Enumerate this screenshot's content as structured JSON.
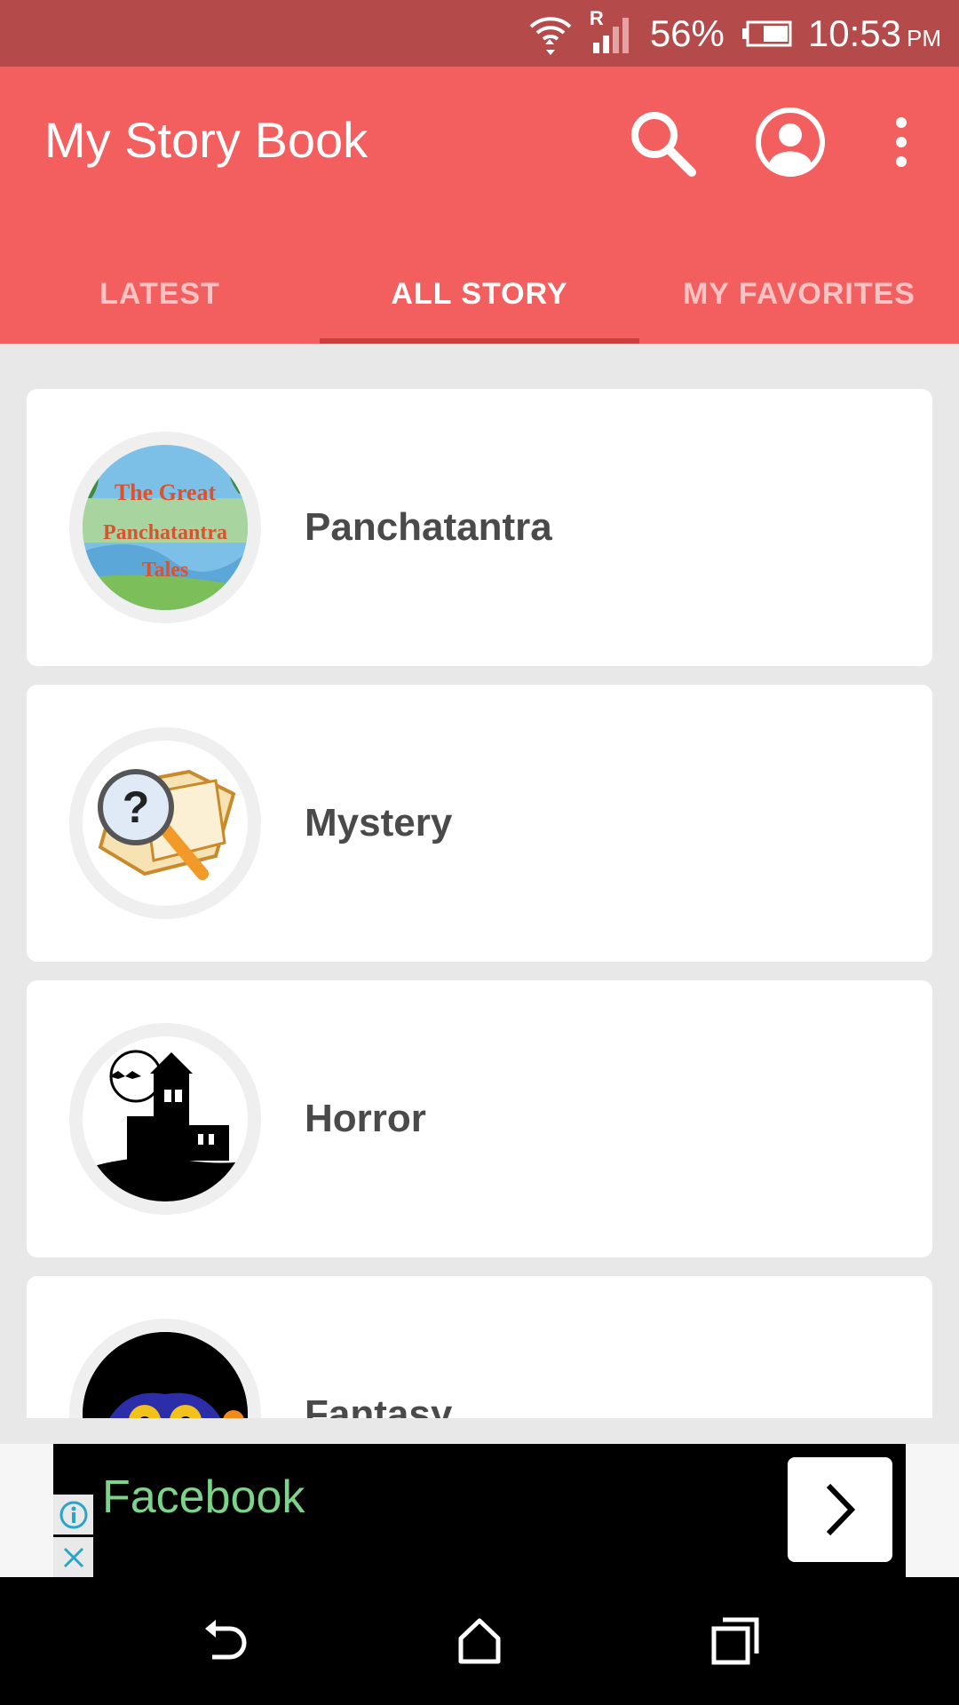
{
  "status_bar": {
    "battery": "56%",
    "time": "10:53",
    "ampm": "PM",
    "network_indicator": "R"
  },
  "app_bar": {
    "title": "My Story Book",
    "icons": [
      "search-icon",
      "account-icon",
      "more-vert-icon"
    ]
  },
  "tabs": [
    {
      "label": "LATEST",
      "active": false
    },
    {
      "label": "ALL STORY",
      "active": true
    },
    {
      "label": "MY FAVORITES",
      "active": false
    }
  ],
  "categories": [
    {
      "label": "Panchatantra",
      "thumb_lines": [
        "The Great",
        "Panchatantra",
        "Tales"
      ]
    },
    {
      "label": "Mystery"
    },
    {
      "label": "Horror"
    },
    {
      "label": "Fantasy"
    }
  ],
  "ad": {
    "text": "Facebook"
  },
  "colors": {
    "status_bar": "#b44a4a",
    "app_bar": "#f35f5f",
    "tab_indicator": "#c9413f",
    "ad_text": "#7bd489"
  }
}
